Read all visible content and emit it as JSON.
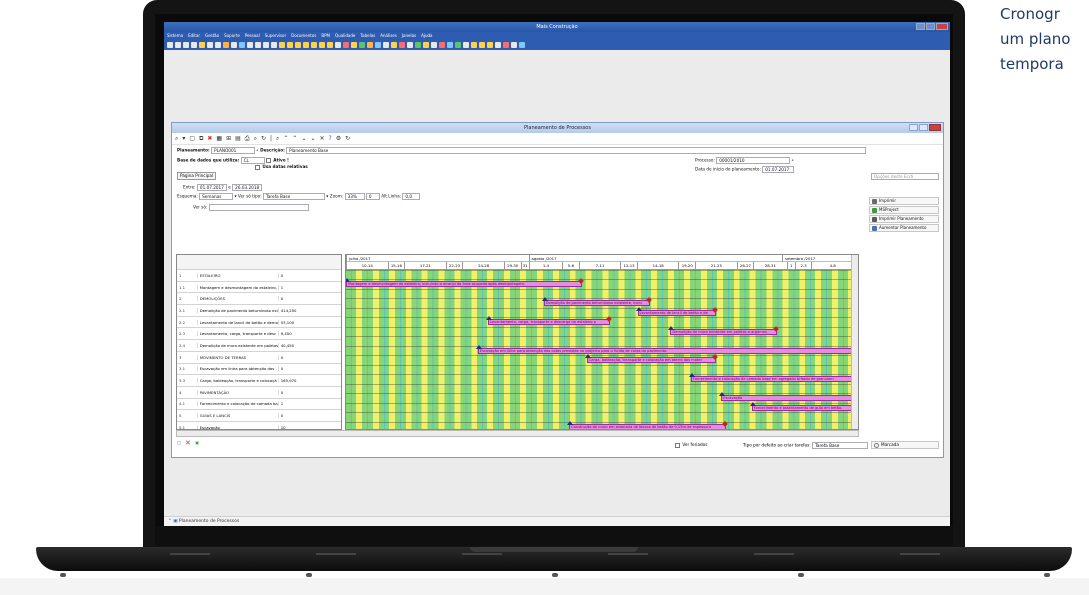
{
  "tagline": {
    "line1": "Cronogr",
    "line2": "um plano",
    "line3": "tempora"
  },
  "app": {
    "title": "Mais Construção",
    "menu": [
      "Sistema",
      "Editar",
      "Gestão",
      "Suporte",
      "Pessoal",
      "Supervisor",
      "Documentos",
      "BPM",
      "Qualidade",
      "Tabelas",
      "Análises",
      "Janelas",
      "Ajuda"
    ],
    "status_tab": "Planeamento de Processos"
  },
  "window": {
    "title": "Planeamento de Processos",
    "planeamento_label": "Planeamento:",
    "planeamento_value": "PLANO001",
    "descricao_label": "Descrição:",
    "descricao_value": "Planeamento Base",
    "base_label": "Base de dados que utiliza:",
    "base_value": "CL",
    "ativo_label": "Ativo !",
    "datas_label": "Usa datas relativas",
    "pagina_btn": "Página Principal",
    "processo_label": "Processo:",
    "processo_value": "00001/2010",
    "data_inicio_label": "Data de início do planeamento:",
    "data_inicio_value": "01.07.2017",
    "entre_label": "Entre:",
    "entre_from": "01.07.2017",
    "entre_sep": "e",
    "entre_to": "26.03.2018",
    "esquema_label": "Esquema:",
    "esquema_value": "Semanas",
    "ver_tipo_label": "Ver só tipo:",
    "ver_tipo_value": "Tarefa Base",
    "zoom_label": "Zoom:",
    "zoom_value": "33%",
    "zoom_num": "0",
    "alt_label": "Alt.Linha:",
    "alt_value": "0,0",
    "ver_so_label": "Ver só:",
    "opcoes_label": "Opções deste Ecrã",
    "ver_feriados": "Ver feriados",
    "tipo_defeito_label": "Tipo por defeito ao criar tarefas:",
    "tipo_defeito_value": "Tarefa Base",
    "marcada_label": "Marcada"
  },
  "side_actions": [
    {
      "label": "Imprimir",
      "icon": "printer-icon",
      "color": "#6a6a6a"
    },
    {
      "label": "MSProject",
      "icon": "msproject-icon",
      "color": "#3d9b3d"
    },
    {
      "label": "Imprimir Planeamento",
      "icon": "print-plan-icon",
      "color": "#5a5a5a"
    },
    {
      "label": "Aumentar Planeamento",
      "icon": "enlarge-icon",
      "color": "#4a6fb8"
    }
  ],
  "months": [
    "julho /2017",
    "agosto /2017",
    "setembro /2017"
  ],
  "weeks": [
    "10-14",
    "15-16",
    "17-21",
    "22-23",
    "24-28",
    "29-30",
    "31",
    "1-4",
    "5-6",
    "7-11",
    "12-13",
    "14-18",
    "19-20",
    "21-25",
    "26-27",
    "28-31",
    "1",
    "2-3",
    "4-8"
  ],
  "tasks": [
    {
      "num": "1",
      "name": "ESTALEIRO",
      "qty": "0"
    },
    {
      "num": "1.1",
      "name": "Montagem e desmontagem do estaleiro, in",
      "qty": "1"
    },
    {
      "num": "2",
      "name": "DEMOLIÇÕES",
      "qty": "0"
    },
    {
      "num": "2.1",
      "name": "Demolição de pavimento betuminoso exis",
      "qty": "414,250"
    },
    {
      "num": "2.2",
      "name": "Levantamento de lancil de betão e demo",
      "qty": "53,100"
    },
    {
      "num": "2.3",
      "name": "Levantamento, carga, transporte e desc",
      "qty": "9,450"
    },
    {
      "num": "2.4",
      "name": "Demolição de muro existente em paletas",
      "qty": "40,450"
    },
    {
      "num": "3",
      "name": "MOVIMENTO DE TERRAS",
      "qty": "0"
    },
    {
      "num": "3.1",
      "name": "Escavação em linha para obtenção das",
      "qty": "0"
    },
    {
      "num": "3.3",
      "name": "Carga, baldeação, transporte e colocaçã",
      "qty": "165,970"
    },
    {
      "num": "4",
      "name": "PAVIMENTAÇÃO",
      "qty": "0"
    },
    {
      "num": "4.1",
      "name": "Fornecimento e colocação de camada ba",
      "qty": "1"
    },
    {
      "num": "5",
      "name": "GUIAS E LANCIS",
      "qty": "0"
    },
    {
      "num": "5.1",
      "name": "Escavação",
      "qty": "10"
    },
    {
      "num": "5.2",
      "name": "Fornecimento e assentamento de guia e",
      "qty": "23,100"
    },
    {
      "num": "6",
      "name": "CONSTRUÇÃO DE MUROS",
      "qty": "0"
    },
    {
      "num": "6.1",
      "name": "Construção de muro em alvenaria de blo",
      "qty": "75,250"
    }
  ],
  "bars": [
    {
      "row": 1,
      "start": 0.0,
      "end": 0.465,
      "label": "Montagem e desmontagem do estaleiro, incluindo o arranjo da área ocupada após desmontagem."
    },
    {
      "row": 3,
      "start": 0.39,
      "end": 0.6,
      "label": "Demolição de pavimento betuminoso existente, inclu"
    },
    {
      "row": 4,
      "start": 0.575,
      "end": 0.73,
      "label": "Levantamento de lancil de betão e de"
    },
    {
      "row": 5,
      "start": 0.28,
      "end": 0.52,
      "label": "Levantamento, carga, transporte e descarga no estaleiro p"
    },
    {
      "row": 6,
      "start": 0.64,
      "end": 0.85,
      "label": "Demolição de muro existente em paletas e argamas"
    },
    {
      "row": 8,
      "start": 0.26,
      "end": 1.0,
      "label": "Escavação em linha para obtenção das cotas previstas no projecto para o fundo de caixa do pavimento."
    },
    {
      "row": 9,
      "start": 0.475,
      "end": 0.73,
      "label": "Carga, baldeação, transporte e colocação em aterro dos mater"
    },
    {
      "row": 11,
      "start": 0.68,
      "end": 1.0,
      "label": "Fornecimento e colocação de camada base em agregado britado de granulom"
    },
    {
      "row": 13,
      "start": 0.74,
      "end": 1.0,
      "label": "Escavação"
    },
    {
      "row": 14,
      "start": 0.8,
      "end": 1.0,
      "label": "Fornecimento e assentamento de guia em betão,"
    },
    {
      "row": 16,
      "start": 0.44,
      "end": 0.75,
      "label": "Construção de muro em alvenaria de blocos de betão de 0,15m de espessura"
    }
  ],
  "colors": {
    "bar": "#e58be0",
    "weekday": "#86d576",
    "weekend": "#f1f06a",
    "accent": "#2e5cb1"
  }
}
